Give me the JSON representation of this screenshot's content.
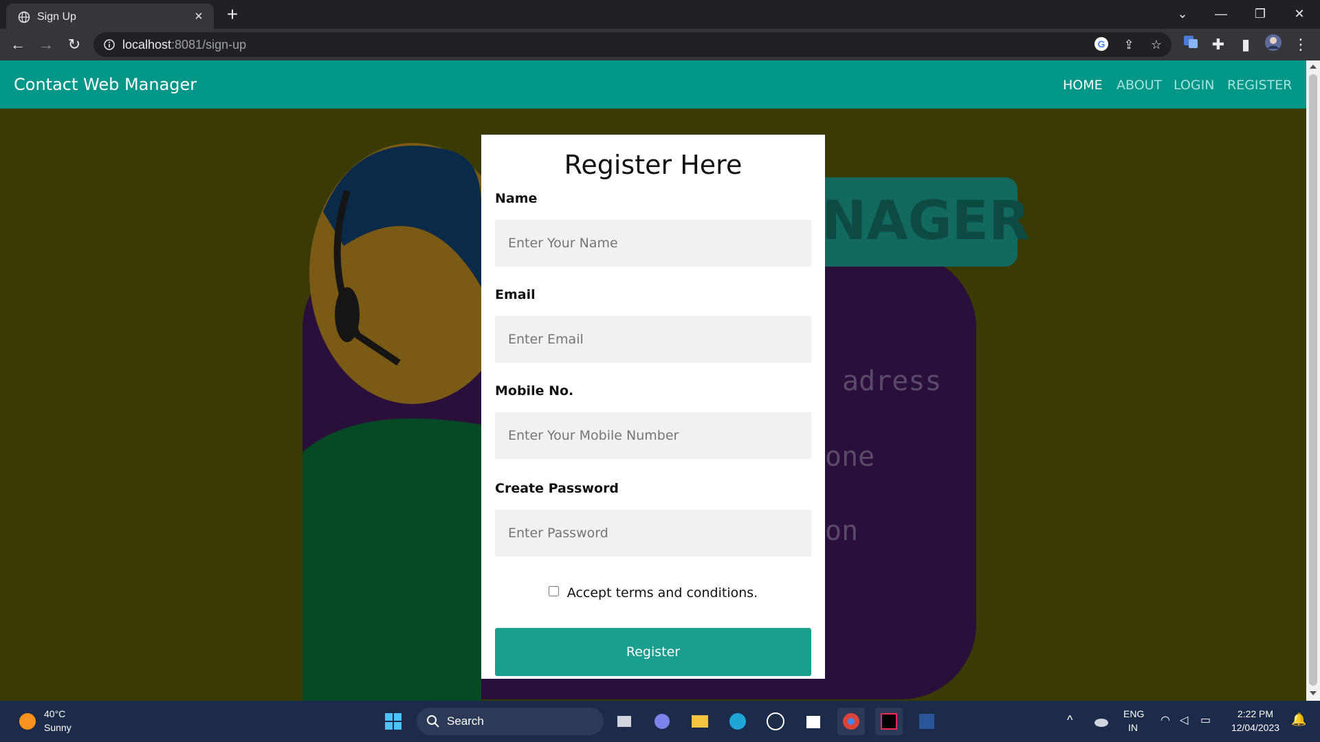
{
  "browser": {
    "tab_title": "Sign Up",
    "tab_close": "×",
    "new_tab": "+",
    "url_host": "localhost",
    "url_rest": ":8081/sign-up"
  },
  "navbar": {
    "brand": "Contact Web Manager",
    "links": [
      "HOME",
      "ABOUT",
      "LOGIN",
      "REGISTER"
    ],
    "active": "HOME"
  },
  "background": {
    "words": [
      "NAGER",
      "adress",
      "one",
      "on"
    ]
  },
  "form": {
    "title": "Register Here",
    "fields": [
      {
        "label": "Name",
        "placeholder": "Enter Your Name",
        "value": ""
      },
      {
        "label": "Email",
        "placeholder": "Enter Email",
        "value": ""
      },
      {
        "label": "Mobile No.",
        "placeholder": "Enter Your Mobile Number",
        "value": ""
      },
      {
        "label": "Create Password",
        "placeholder": "Enter Password",
        "value": ""
      }
    ],
    "terms_label": "Accept terms and conditions.",
    "terms_checked": false,
    "submit_label": "Register"
  },
  "taskbar": {
    "weather_temp": "40°C",
    "weather_cond": "Sunny",
    "search_label": "Search",
    "lang_top": "ENG",
    "lang_bottom": "IN",
    "time": "2:22 PM",
    "date": "12/04/2023"
  },
  "colors": {
    "navbar": "#009688",
    "button": "#1a9e8e",
    "page_bg": "#3a3a05"
  }
}
